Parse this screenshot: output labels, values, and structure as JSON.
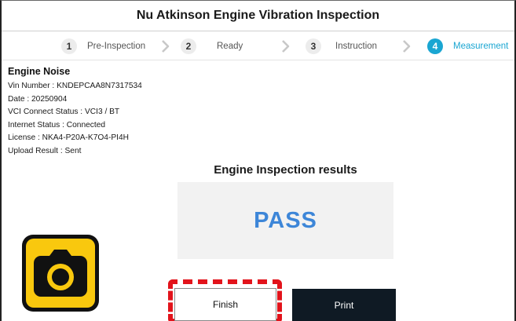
{
  "window": {
    "title": "Nu Atkinson Engine Vibration Inspection"
  },
  "steps": [
    {
      "number": "1",
      "label": "Pre-Inspection",
      "active": false
    },
    {
      "number": "2",
      "label": "Ready",
      "active": false
    },
    {
      "number": "3",
      "label": "Instruction",
      "active": false
    },
    {
      "number": "4",
      "label": "Measurement",
      "active": true
    }
  ],
  "info": {
    "title": "Engine Noise",
    "lines": [
      "Vin Number : KNDEPCAA8N7317534",
      "Date : 20250904",
      "VCI Connect Status : VCI3 / BT",
      "Internet Status : Connected",
      "License : NKA4-P20A-K7O4-PI4H",
      "Upload Result : Sent"
    ]
  },
  "results": {
    "title": "Engine Inspection results",
    "value": "PASS"
  },
  "buttons": {
    "finish": "Finish",
    "print": "Print"
  },
  "icons": {
    "camera": "camera-app-icon",
    "chevron": "chevron-right-icon"
  },
  "colors": {
    "accent": "#1aa6d2",
    "pass": "#3d86d8",
    "highlight": "#e2131b",
    "camera_bg": "#f9c80e",
    "print_bg": "#0f1a24"
  }
}
